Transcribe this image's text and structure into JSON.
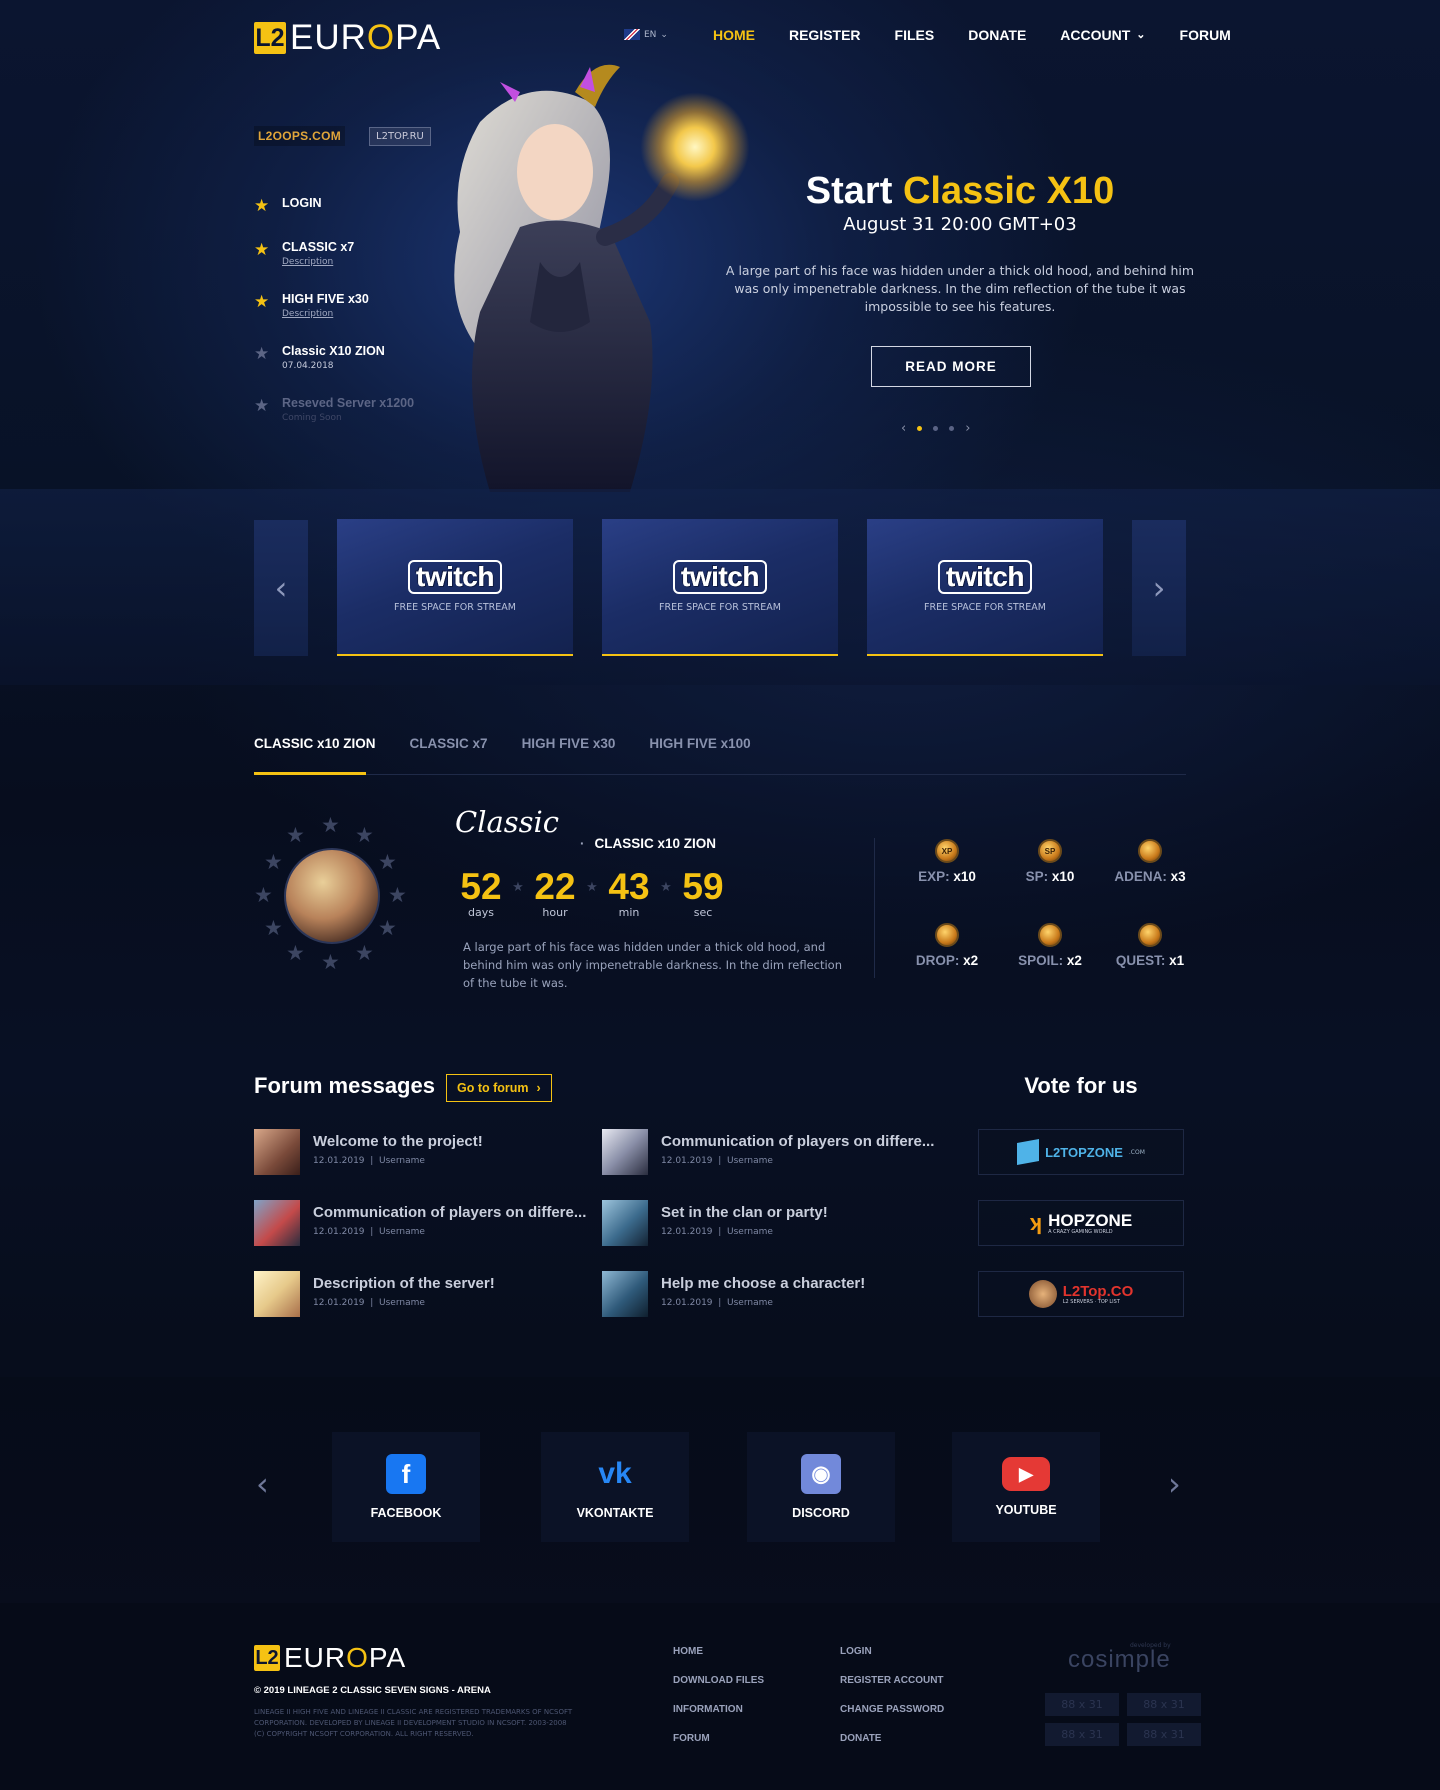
{
  "header": {
    "logo": {
      "mark": "L2",
      "text_before": "EUR",
      "text_o": "O",
      "text_after": "PA"
    },
    "lang": "EN",
    "nav": [
      {
        "label": "HOME"
      },
      {
        "label": "REGISTER"
      },
      {
        "label": "FILES"
      },
      {
        "label": "DONATE"
      },
      {
        "label": "ACCOUNT"
      },
      {
        "label": "FORUM"
      }
    ]
  },
  "partners": [
    "L2OOPS.COM",
    "L2TOP.RU"
  ],
  "servers": [
    {
      "name": "LOGIN",
      "sub": ""
    },
    {
      "name": "CLASSIC x7",
      "sub": "Description"
    },
    {
      "name": "HIGH FIVE x30",
      "sub": "Description"
    },
    {
      "name": "Classic X10 ZION",
      "sub": "07.04.2018"
    },
    {
      "name": "Reseved Server x1200",
      "sub": "Coming Soon"
    }
  ],
  "hero": {
    "title_prefix": "Start",
    "title_highlight": "Classic X10",
    "date": "August 31 20:00 GMT+03",
    "description": "A large part of his face was hidden under a thick old hood, and behind him was only impenetrable darkness. In the dim reflection of the tube it was impossible to see his features.",
    "button": "READ MORE",
    "slide_count": 3,
    "active_slide": 1
  },
  "streams": [
    {
      "brand": "twitch",
      "label": "FREE SPACE FOR STREAM"
    },
    {
      "brand": "twitch",
      "label": "FREE SPACE FOR STREAM"
    },
    {
      "brand": "twitch",
      "label": "FREE SPACE FOR STREAM"
    }
  ],
  "tabs": [
    {
      "label": "CLASSIC x10 ZION"
    },
    {
      "label": "CLASSIC x7"
    },
    {
      "label": "HIGH FIVE x30"
    },
    {
      "label": "HIGH FIVE x100"
    }
  ],
  "server_info": {
    "logo_text": "Classic",
    "name": "CLASSIC x10 ZION",
    "countdown": [
      {
        "value": "52",
        "label": "days"
      },
      {
        "value": "22",
        "label": "hour"
      },
      {
        "value": "43",
        "label": "min"
      },
      {
        "value": "59",
        "label": "sec"
      }
    ],
    "description": "A large part of his face was hidden under a thick old hood, and behind him was only impenetrable darkness. In the dim reflection of the tube it was.",
    "rates": [
      {
        "label": "EXP:",
        "value": "x10",
        "icon": "XP"
      },
      {
        "label": "SP:",
        "value": "x10",
        "icon": "SP"
      },
      {
        "label": "ADENA:",
        "value": "x3",
        "icon": ""
      },
      {
        "label": "DROP:",
        "value": "x2",
        "icon": ""
      },
      {
        "label": "SPOIL:",
        "value": "x2",
        "icon": ""
      },
      {
        "label": "QUEST:",
        "value": "x1",
        "icon": ""
      }
    ]
  },
  "forum": {
    "title": "Forum messages",
    "button": "Go to forum",
    "posts": [
      {
        "title": "Welcome to the project!",
        "date": "12.01.2019",
        "user": "Username",
        "thumb": "#7a4a3a"
      },
      {
        "title": "Communication of players on differe...",
        "date": "12.01.2019",
        "user": "Username",
        "thumb": "#c9ccd8"
      },
      {
        "title": "Communication of players on differe...",
        "date": "12.01.2019",
        "user": "Username",
        "thumb": "#4a6b9a"
      },
      {
        "title": "Set in the clan or party!",
        "date": "12.01.2019",
        "user": "Username",
        "thumb": "#3b6a8c"
      },
      {
        "title": "Description of the server!",
        "date": "12.01.2019",
        "user": "Username",
        "thumb": "#e6c98a"
      },
      {
        "title": "Help me choose a character!",
        "date": "12.01.2019",
        "user": "Username",
        "thumb": "#2f5a7a"
      }
    ]
  },
  "vote": {
    "title": "Vote for us",
    "sites": [
      {
        "name": "L2TOPZONE",
        "sub": ".COM",
        "color": "#4fb3e8"
      },
      {
        "name": "HOPZONE",
        "sub": "A CRAZY GAMING WORLD",
        "color": "#ffffff"
      },
      {
        "name": "L2Top.CO",
        "sub": "L2 SERVERS · TOP LIST",
        "color": "#e2342d"
      }
    ]
  },
  "social": [
    {
      "label": "FACEBOOK",
      "glyph": "f",
      "color": "#1877f2"
    },
    {
      "label": "VKONTAKTE",
      "glyph": "vk",
      "color": "#2787f5"
    },
    {
      "label": "DISCORD",
      "glyph": "◉",
      "color": "#7289da"
    },
    {
      "label": "YOUTUBE",
      "glyph": "▶",
      "color": "#e53935"
    }
  ],
  "footer": {
    "copyright": "© 2019 LINEAGE 2 CLASSIC SEVEN SIGNS - ARENA",
    "legal": "LINEAGE II HIGH FIVE AND LINEAGE II CLASSIC ARE REGISTERED TRADEMARKS OF NCSOFT CORPORATION. DEVELOPED BY LINEAGE II DEVELOPMENT STUDIO IN NCSOFT. 2003-2008 (C) COPYRIGHT NCSOFT CORPORATION. ALL RIGHT RESERVED.",
    "col1": [
      "HOME",
      "DOWNLOAD FILES",
      "INFORMATION",
      "FORUM"
    ],
    "col2": [
      "LOGIN",
      "REGISTER ACCOUNT",
      "CHANGE PASSWORD",
      "DONATE"
    ],
    "brand": "cosimple",
    "brand_sub": "developed by",
    "counters": [
      "88 x 31",
      "88 x 31",
      "88 x 31",
      "88 x 31"
    ]
  }
}
